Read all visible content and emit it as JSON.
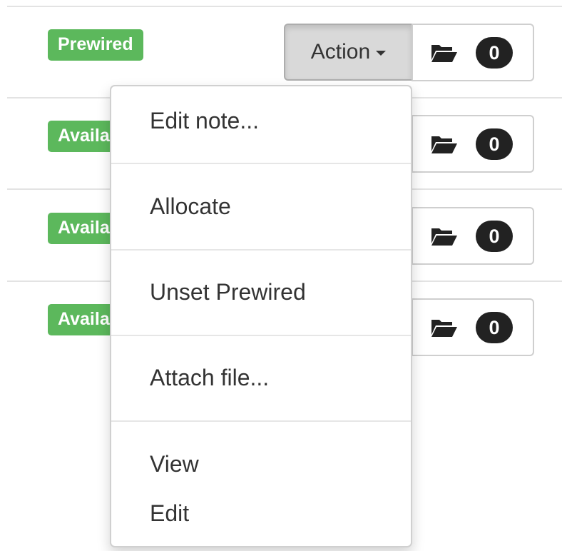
{
  "rows": [
    {
      "badge": "Prewired",
      "file_count": "0"
    },
    {
      "badge": "Available",
      "file_count": "0"
    },
    {
      "badge": "Available",
      "file_count": "0"
    },
    {
      "badge": "Available",
      "file_count": "0"
    }
  ],
  "action_button": {
    "label": "Action"
  },
  "menu": {
    "items": [
      "Edit note...",
      "Allocate",
      "Unset Prewired",
      "Attach file...",
      "View",
      "Edit"
    ]
  },
  "icons": {
    "files": "folder-open-icon",
    "dropdown": "caret-down-icon"
  },
  "colors": {
    "success_badge": "#5cb85c",
    "count_badge": "#222222",
    "button_active": "#d9d9d9"
  }
}
